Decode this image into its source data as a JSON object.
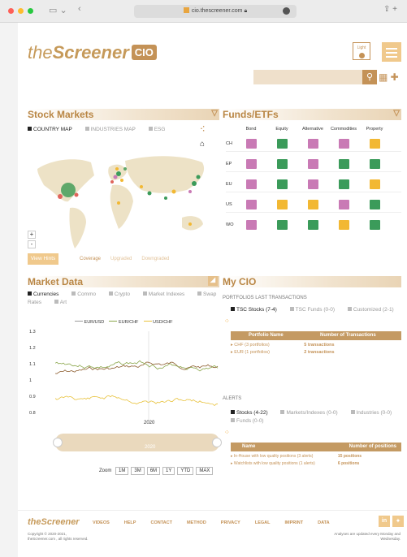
{
  "browser": {
    "url": "cio.thescreener.com"
  },
  "header": {
    "logo_the": "the",
    "logo_screener": "Screener",
    "logo_cio": "CIO",
    "theme_label": "Light"
  },
  "stock": {
    "title": "Stock Markets",
    "tabs": [
      "COUNTRY MAP",
      "INDUSTRIES MAP",
      "ESG"
    ],
    "view_hints": "View Hints",
    "legend": [
      "Coverage",
      "Upgraded",
      "Downgraded"
    ]
  },
  "funds": {
    "title": "Funds/ETFs",
    "cols": [
      "Bond",
      "Equity",
      "Alternative",
      "Commodities",
      "Property"
    ],
    "rows": [
      "CH",
      "EP",
      "EU",
      "US",
      "WO"
    ],
    "grid": [
      [
        "#c97ab5",
        "#3b9b5a",
        "#c97ab5",
        "#c97ab5",
        "#f2b833"
      ],
      [
        "#c97ab5",
        "#3b9b5a",
        "#c97ab5",
        "#3b9b5a",
        "#3b9b5a"
      ],
      [
        "#c97ab5",
        "#3b9b5a",
        "#c97ab5",
        "#3b9b5a",
        "#f2b833"
      ],
      [
        "#c97ab5",
        "#f2b833",
        "#f2b833",
        "#c97ab5",
        "#3b9b5a"
      ],
      [
        "#c97ab5",
        "#3b9b5a",
        "#3b9b5a",
        "#f2b833",
        "#3b9b5a"
      ]
    ]
  },
  "market": {
    "title": "Market Data",
    "tabs": [
      "Currencies",
      "Commo",
      "Crypto",
      "Market Indexes",
      "Swap Rates",
      "Art"
    ],
    "legend": [
      "EUR/USD",
      "EUR/CHF",
      "USD/CHF"
    ],
    "yticks": [
      "1.3",
      "1.2",
      "1.1",
      "1",
      "0.9",
      "0.8"
    ],
    "xtick": "2020",
    "nav_tick": "2020",
    "zoom_label": "Zoom",
    "zoom": [
      "1M",
      "3M",
      "6M",
      "1Y",
      "YTD",
      "MAX"
    ]
  },
  "cio": {
    "title": "My CIO",
    "portfolios_title": "PORTFOLIOS LAST TRANSACTIONS",
    "ptabs": [
      "TSC Stocks (7-4)",
      "TSC Funds (0-0)",
      "Customized (2-1)"
    ],
    "ptable_head": [
      "Portfolio Name",
      "Number of Transactions"
    ],
    "prows": [
      {
        "name": "CHF (3 portfolios)",
        "val": "5 transactions"
      },
      {
        "name": "EUR (1 portfolios)",
        "val": "2 transactions"
      }
    ],
    "alerts_title": "ALERTS",
    "atabs": [
      "Stocks (4-22)",
      "Markets/Indexes (0-0)",
      "Industries (0-0)",
      "Funds (0-0)"
    ],
    "atable_head": [
      "Name",
      "Number of positions"
    ],
    "arows": [
      {
        "name": "In-House with low quality positions (3 alerts)",
        "val": "15 positions"
      },
      {
        "name": "Watchlists with low quality positions (1 alerts)",
        "val": "6 positions"
      }
    ]
  },
  "footer": {
    "logo": "theScreener",
    "nav": [
      "VIDEOS",
      "HELP",
      "CONTACT",
      "METHOD",
      "PRIVACY",
      "LEGAL",
      "IMPRINT",
      "DATA"
    ],
    "copyright": "Copyright © 2020-2021, theScreener.com , all rights reserved.",
    "note": "Analyses are updated every Monday and Wednesday."
  }
}
